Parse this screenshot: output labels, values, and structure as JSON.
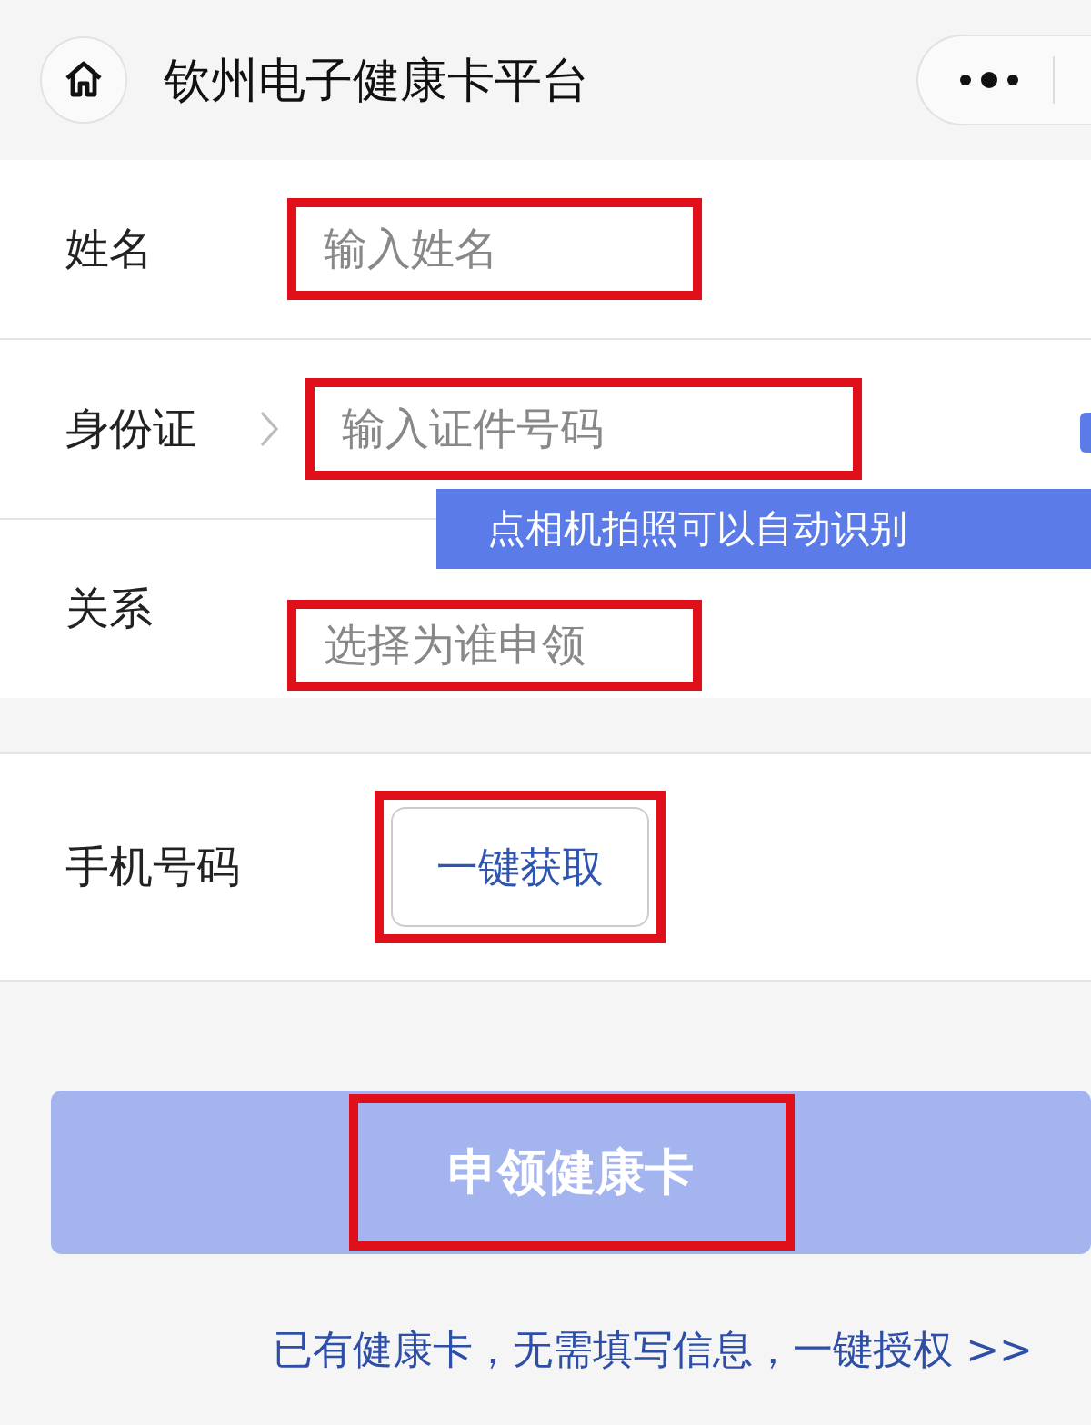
{
  "header": {
    "title": "钦州电子健康卡平台"
  },
  "fields": [
    {
      "label": "姓名",
      "placeholder": "输入姓名",
      "chevron": false,
      "annotated": true
    },
    {
      "label": "身份证",
      "placeholder": "输入证件号码",
      "chevron": true,
      "annotated": true
    },
    {
      "label": "关系",
      "placeholder": "选择为谁申领",
      "chevron": false,
      "annotated": true
    }
  ],
  "tooltip": {
    "text": "点相机拍照可以自动识别"
  },
  "phone": {
    "label": "手机号码",
    "button": "一键获取",
    "annotated": true
  },
  "submit": {
    "label": "申领健康卡",
    "disabled": true,
    "annotated": true
  },
  "authorize_link": "已有健康卡，无需填写信息，一键授权 >>"
}
